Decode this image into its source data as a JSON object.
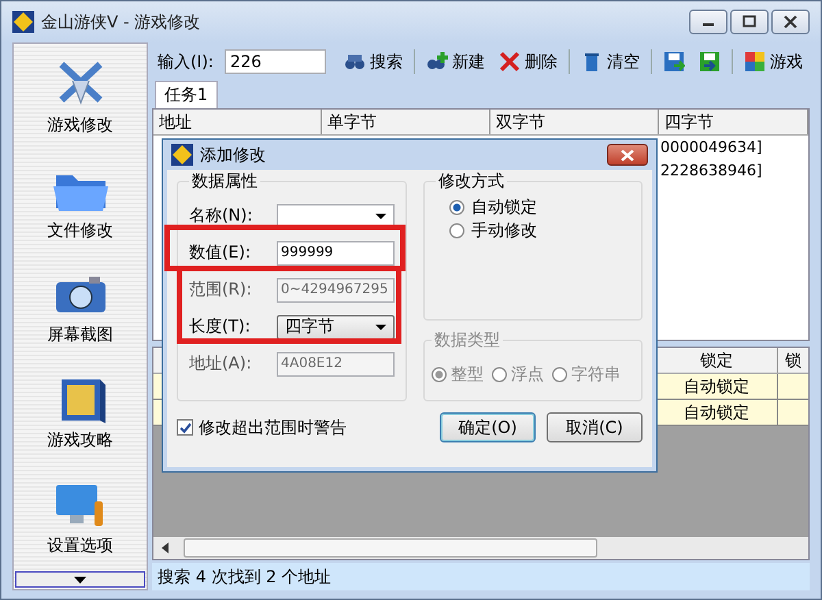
{
  "window": {
    "title": "金山游侠V - 游戏修改"
  },
  "sidebar": {
    "items": [
      {
        "label": "游戏修改",
        "kind": "swords"
      },
      {
        "label": "文件修改",
        "kind": "folder"
      },
      {
        "label": "屏幕截图",
        "kind": "camera"
      },
      {
        "label": "游戏攻略",
        "kind": "book"
      },
      {
        "label": "设置选项",
        "kind": "monitor"
      }
    ]
  },
  "toolbar": {
    "input_label": "输入(I):",
    "input_value": "226",
    "buttons": [
      {
        "label": "搜索",
        "kind": "binoculars"
      },
      {
        "label": "新建",
        "kind": "new"
      },
      {
        "label": "删除",
        "kind": "delete"
      },
      {
        "label": "清空",
        "kind": "trash"
      },
      {
        "kind": "save"
      },
      {
        "kind": "load"
      },
      {
        "label": "游戏",
        "kind": "game"
      }
    ]
  },
  "tabs": [
    {
      "label": "任务1",
      "selected": true
    }
  ],
  "results_table": {
    "columns": [
      "地址",
      "单字节",
      "双字节",
      "四字节"
    ],
    "rows": [
      {
        "column_4": "0000049634]"
      },
      {
        "column_4": "2228638946]"
      }
    ]
  },
  "lock_table": {
    "columns": [
      "锁定",
      "锁"
    ],
    "rows": [
      {
        "lock": "自动锁定"
      },
      {
        "lock": "自动锁定"
      }
    ]
  },
  "status_bar": {
    "text": "搜索 4 次找到 2 个地址"
  },
  "dialog": {
    "title": "添加修改",
    "data_group": {
      "title": "数据属性",
      "fields": [
        {
          "label": "名称(N):",
          "kind": "dropdown",
          "disabled": false
        },
        {
          "label": "数值(E):",
          "kind": "text",
          "value": "999999",
          "disabled": false
        },
        {
          "label": "范围(R):",
          "kind": "text",
          "value": "0~4294967295",
          "disabled": true
        },
        {
          "label": "长度(T):",
          "kind": "dropdown",
          "value": "四字节",
          "disabled": false
        },
        {
          "label": "地址(A):",
          "kind": "text",
          "value": "4A08E12",
          "disabled": true
        }
      ]
    },
    "mode_group": {
      "title": "修改方式",
      "options": [
        {
          "label": "自动锁定",
          "selected": true
        },
        {
          "label": "手动修改",
          "selected": false
        }
      ]
    },
    "type_group": {
      "title": "数据类型",
      "disabled": true,
      "options": [
        {
          "label": "整型",
          "selected": true
        },
        {
          "label": "浮点",
          "selected": false
        },
        {
          "label": "字符串",
          "selected": false
        }
      ]
    },
    "warn_checkbox": {
      "label": "修改超出范围时警告",
      "checked": true
    },
    "buttons": [
      "确定(O)",
      "取消(C)"
    ]
  }
}
